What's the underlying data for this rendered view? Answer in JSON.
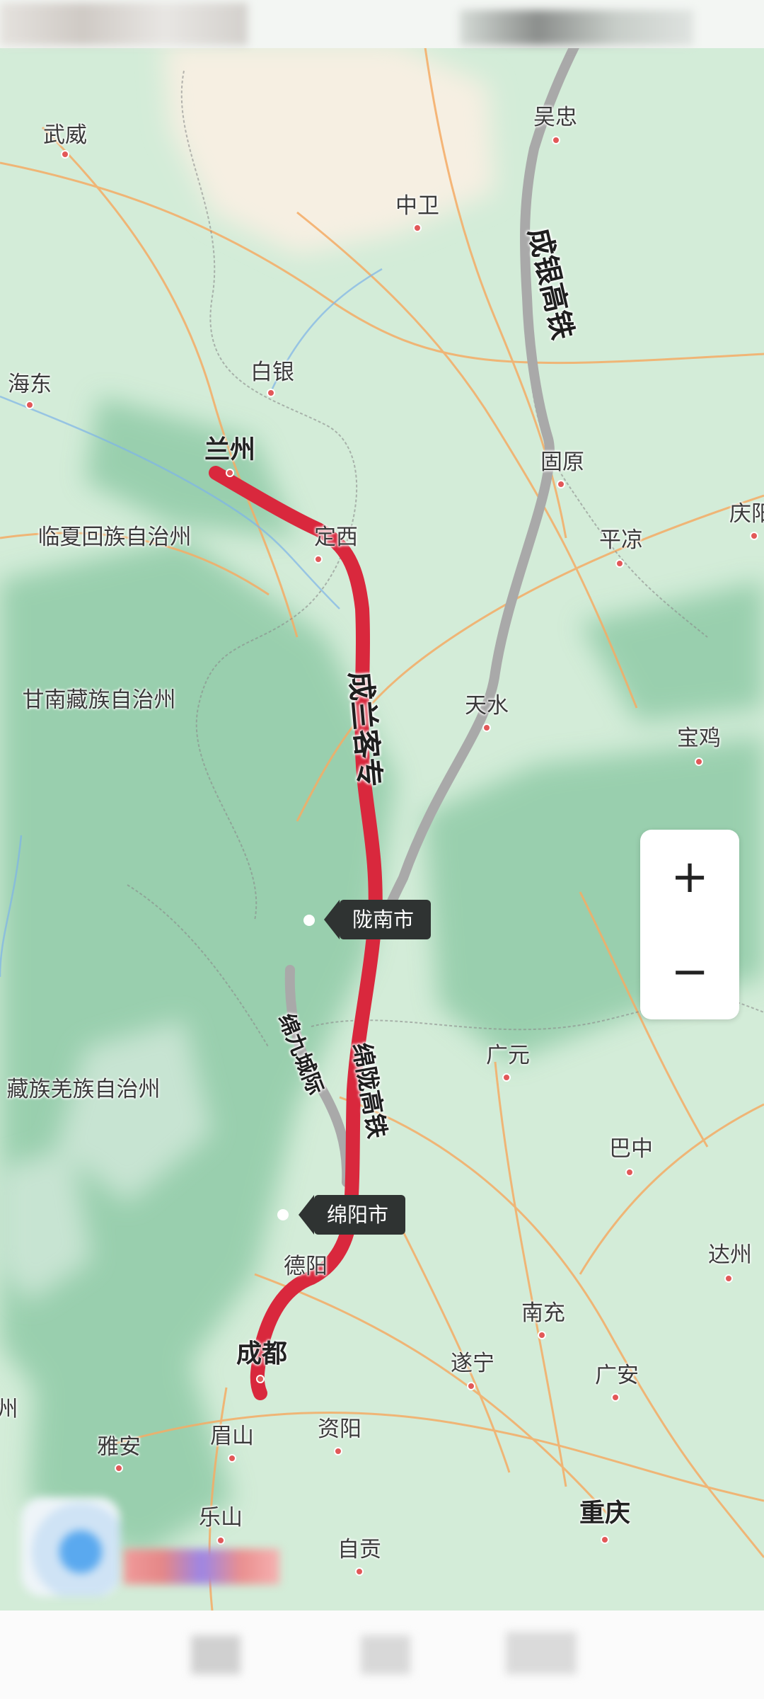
{
  "map": {
    "cities": [
      {
        "id": "wuwei",
        "name": "武威",
        "big": false
      },
      {
        "id": "zhongwei",
        "name": "中卫",
        "big": false
      },
      {
        "id": "wuzhong",
        "name": "吴忠",
        "big": false
      },
      {
        "id": "haidong",
        "name": "海东",
        "big": false
      },
      {
        "id": "baiyin",
        "name": "白银",
        "big": false
      },
      {
        "id": "lanzhou",
        "name": "兰州",
        "big": true
      },
      {
        "id": "guyuan",
        "name": "固原",
        "big": false
      },
      {
        "id": "linxia",
        "name": "临夏回族自治州",
        "big": false
      },
      {
        "id": "dingxi",
        "name": "定西",
        "big": false
      },
      {
        "id": "pingliang",
        "name": "平凉",
        "big": false
      },
      {
        "id": "qingyang",
        "name": "庆阳",
        "big": false
      },
      {
        "id": "gannan",
        "name": "甘南藏族自治州",
        "big": false
      },
      {
        "id": "tianshui",
        "name": "天水",
        "big": false
      },
      {
        "id": "baoji",
        "name": "宝鸡",
        "big": false
      },
      {
        "id": "guangyuan",
        "name": "广元",
        "big": false
      },
      {
        "id": "aba",
        "name": "藏族羌族自治州",
        "big": false
      },
      {
        "id": "bazhong",
        "name": "巴中",
        "big": false
      },
      {
        "id": "dazhou",
        "name": "达州",
        "big": false
      },
      {
        "id": "deyang",
        "name": "德阳",
        "big": false
      },
      {
        "id": "nanchong",
        "name": "南充",
        "big": false
      },
      {
        "id": "chengdu",
        "name": "成都",
        "big": true
      },
      {
        "id": "suining",
        "name": "遂宁",
        "big": false
      },
      {
        "id": "guangan",
        "name": "广安",
        "big": false
      },
      {
        "id": "yaan",
        "name": "雅安",
        "big": false
      },
      {
        "id": "meishan",
        "name": "眉山",
        "big": false
      },
      {
        "id": "ziyang",
        "name": "资阳",
        "big": false
      },
      {
        "id": "leshan",
        "name": "乐山",
        "big": false
      },
      {
        "id": "chongqing",
        "name": "重庆",
        "big": true
      },
      {
        "id": "zigong",
        "name": "自贡",
        "big": false
      },
      {
        "id": "edge-zhou",
        "name": "州",
        "big": false
      }
    ],
    "rail_labels": [
      {
        "id": "chengyin",
        "name": "成银高铁"
      },
      {
        "id": "chenglan",
        "name": "成兰客专"
      },
      {
        "id": "mianlong",
        "name": "绵陇高铁"
      },
      {
        "id": "mianjiu",
        "name": "绵九城际"
      }
    ],
    "tags": [
      {
        "id": "longnan",
        "name": "陇南市"
      },
      {
        "id": "mianyang",
        "name": "绵阳市"
      }
    ],
    "colors": {
      "highlight_rail": "#d9283d",
      "other_rail": "#a9a9a9",
      "land": "#d3ecd8",
      "mountain": "#7fc29a",
      "road": "#f4a860"
    }
  },
  "zoom": {
    "in": "+",
    "out": "−"
  }
}
